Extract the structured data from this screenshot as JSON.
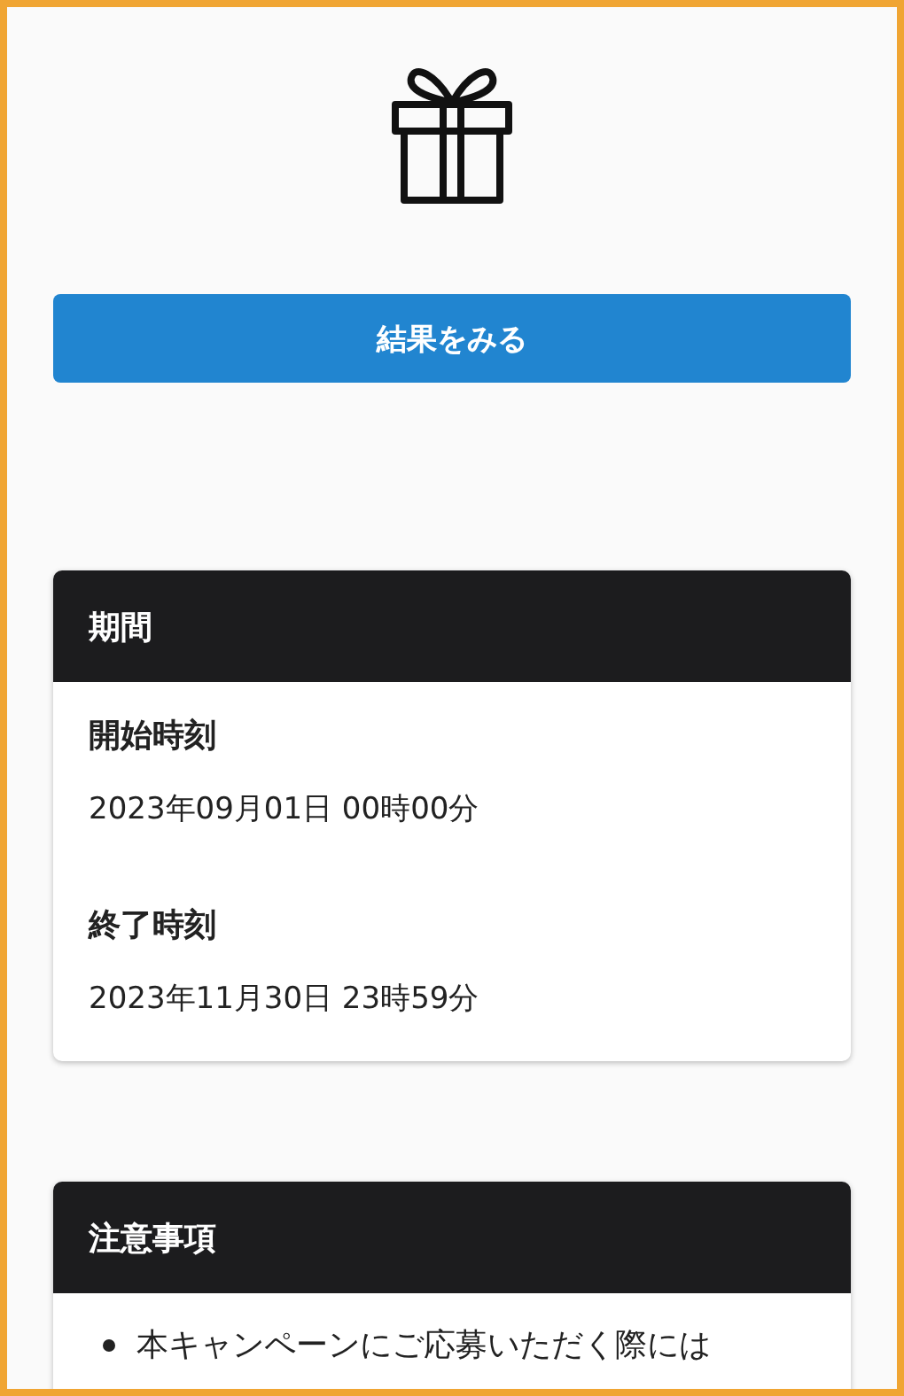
{
  "button": {
    "label": "結果をみる"
  },
  "period": {
    "title": "期間",
    "fields": [
      {
        "label": "開始時刻",
        "value": "2023年09月01日 00時00分"
      },
      {
        "label": "終了時刻",
        "value": "2023年11月30日 23時59分"
      }
    ]
  },
  "notes": {
    "title": "注意事項",
    "items": [
      "本キャンペーンにご応募いただく際には"
    ]
  }
}
